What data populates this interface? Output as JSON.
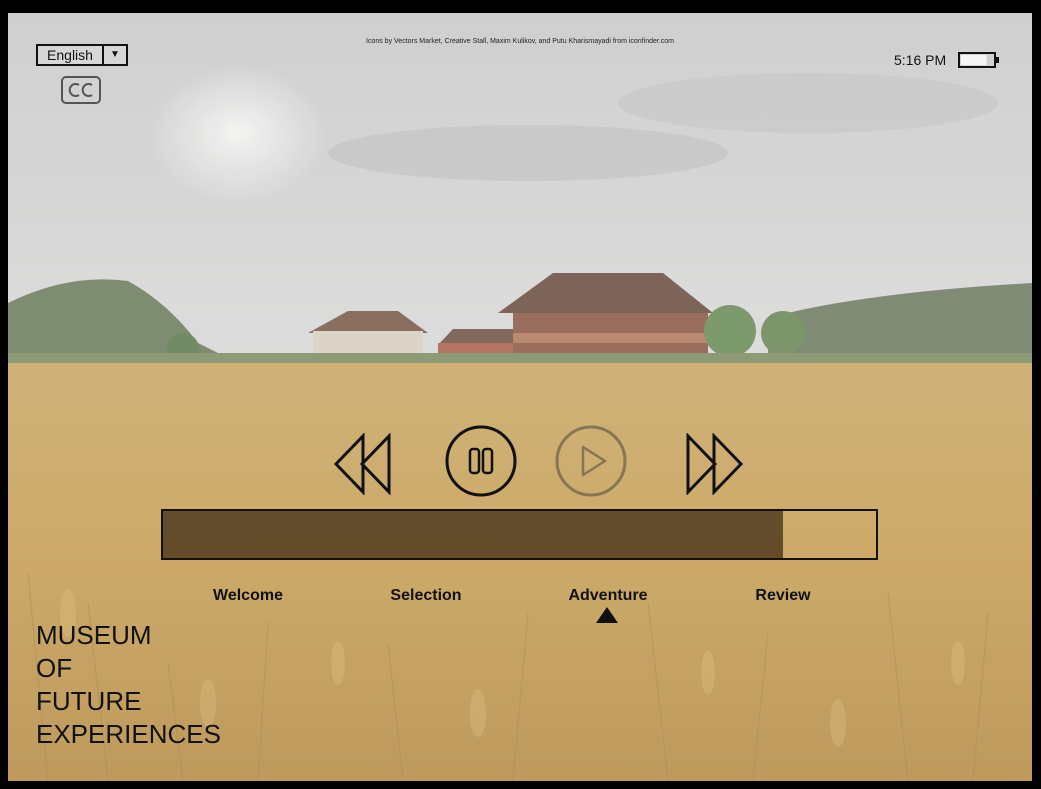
{
  "credits": "Icons by Vectors Market, Creative Stall, Maxim Kulikov, and Putu Kharismayadi from iconfinder.com",
  "language": {
    "selected": "English",
    "dropdown_icon": "triangle-down-icon"
  },
  "captions_icon": "closed-captions-icon",
  "status": {
    "time": "5:16 PM",
    "battery_icon": "battery-icon",
    "battery_level": 0.8
  },
  "player": {
    "icons": [
      "rewind-icon",
      "pause-icon",
      "play-icon",
      "fast-forward-icon"
    ],
    "progress": 0.87
  },
  "stages": [
    {
      "label": "Welcome"
    },
    {
      "label": "Selection"
    },
    {
      "label": "Adventure"
    },
    {
      "label": "Review"
    }
  ],
  "current_stage": "Adventure",
  "museum_title": [
    "MUSEUM",
    "OF",
    "FUTURE",
    "EXPERIENCES"
  ],
  "colors": {
    "overlay_fill": "#3c2814",
    "stroke": "#111111"
  }
}
